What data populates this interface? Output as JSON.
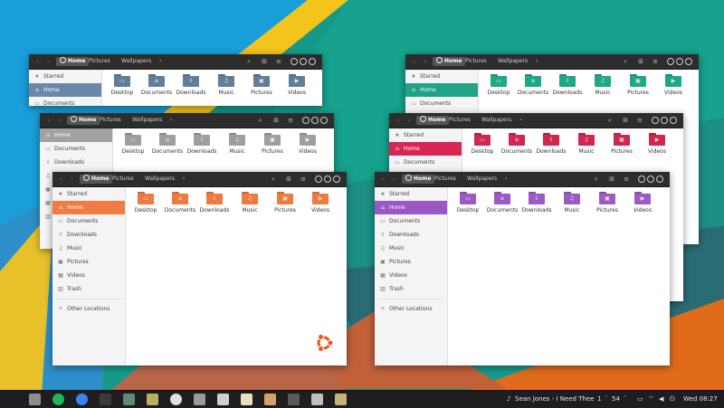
{
  "window": {
    "nav_back": "‹",
    "nav_fwd": "›",
    "breadcrumbs": [
      "Home",
      "Pictures",
      "Wallpapers"
    ],
    "crumb_more": "›",
    "search_icon": "search-icon",
    "view_icon": "view-options-icon",
    "menu_icon": "hamburger-menu-icon"
  },
  "sidebar": {
    "items": [
      {
        "label": "Starred",
        "icon": "star-icon",
        "glyph": "★"
      },
      {
        "label": "Home",
        "icon": "home-icon",
        "glyph": "⌂"
      },
      {
        "label": "Documents",
        "icon": "documents-icon",
        "glyph": "▭"
      },
      {
        "label": "Downloads",
        "icon": "downloads-icon",
        "glyph": "⇩"
      },
      {
        "label": "Music",
        "icon": "music-icon",
        "glyph": "♫"
      },
      {
        "label": "Pictures",
        "icon": "pictures-icon",
        "glyph": "▣"
      },
      {
        "label": "Videos",
        "icon": "videos-icon",
        "glyph": "▦"
      },
      {
        "label": "Trash",
        "icon": "trash-icon",
        "glyph": "▥"
      }
    ],
    "other": {
      "label": "Other Locations",
      "icon": "plus-icon",
      "glyph": "+"
    }
  },
  "folders": [
    {
      "label": "Desktop",
      "icon": "desktop-folder-icon",
      "glyph": "▭"
    },
    {
      "label": "Documents",
      "icon": "documents-folder-icon",
      "glyph": "≡"
    },
    {
      "label": "Downloads",
      "icon": "downloads-folder-icon",
      "glyph": "⇩"
    },
    {
      "label": "Music",
      "icon": "music-folder-icon",
      "glyph": "♫"
    },
    {
      "label": "Pictures",
      "icon": "pictures-folder-icon",
      "glyph": "▣"
    },
    {
      "label": "Videos",
      "icon": "videos-folder-icon",
      "glyph": "▶"
    }
  ],
  "themes": [
    {
      "name": "blue-grey",
      "folder": "#607d99",
      "selected": "#6c88a8"
    },
    {
      "name": "grey",
      "folder": "#9e9e9e",
      "selected": "#a2a2a2"
    },
    {
      "name": "orange",
      "folder": "#ef7a3f",
      "selected": "#f07c44"
    },
    {
      "name": "teal",
      "folder": "#1ea88a",
      "selected": "#20a386"
    },
    {
      "name": "crimson",
      "folder": "#d0264f",
      "selected": "#d82656"
    },
    {
      "name": "purple",
      "folder": "#9b5bc2",
      "selected": "#9a57c5"
    }
  ],
  "taskbar": {
    "apps": [
      {
        "name": "files-icon",
        "color": "#8d8d8d"
      },
      {
        "name": "spotify-icon",
        "color": "#1db954"
      },
      {
        "name": "chrome-icon",
        "color": "#3b82f6"
      },
      {
        "name": "terminal-icon",
        "color": "#3a3a3a"
      },
      {
        "name": "system-monitor-icon",
        "color": "#5f8a73"
      },
      {
        "name": "image-viewer-icon",
        "color": "#b8b060"
      },
      {
        "name": "disks-icon",
        "color": "#e0e0e0"
      },
      {
        "name": "calculator-icon",
        "color": "#9a9a9a"
      },
      {
        "name": "chat-icon",
        "color": "#cfcfcf"
      },
      {
        "name": "text-editor-icon",
        "color": "#e9e0c0"
      },
      {
        "name": "software-store-icon",
        "color": "#d6a06c"
      },
      {
        "name": "screenshot-icon",
        "color": "#5a5a5a"
      },
      {
        "name": "game-controller-icon",
        "color": "#bfbfbf"
      },
      {
        "name": "photos-icon",
        "color": "#c9b27a"
      }
    ],
    "now_playing": "Sean Jones - I Need Thee",
    "workspace": "1",
    "volume_value": "54",
    "clock": "Wed 08:27"
  },
  "colors": {
    "wall_blue": "#1a9ed9",
    "wall_teal": "#18a58a",
    "wall_yellow": "#f3c51c",
    "wall_orange": "#e06b1b",
    "headerbar": "#2d2d2d",
    "taskbar": "#1e1e1e"
  }
}
